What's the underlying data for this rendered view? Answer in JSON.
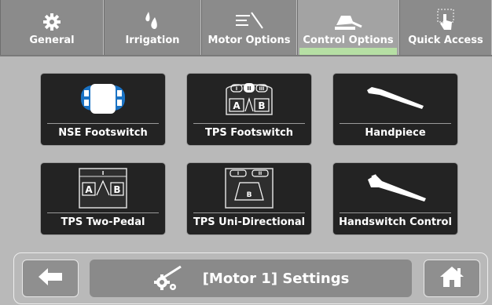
{
  "tabs": [
    {
      "label": "General",
      "icon": "gear-icon"
    },
    {
      "label": "Irrigation",
      "icon": "water-drops-icon"
    },
    {
      "label": "Motor Options",
      "icon": "motor-options-icon"
    },
    {
      "label": "Control Options",
      "icon": "control-options-icon",
      "active": true
    },
    {
      "label": "Quick Access",
      "icon": "touch-hand-icon"
    }
  ],
  "tiles": [
    {
      "label": "NSE Footswitch",
      "icon": "nse-footswitch-icon"
    },
    {
      "label": "TPS Footswitch",
      "icon": "tps-footswitch-icon"
    },
    {
      "label": "Handpiece",
      "icon": "handpiece-icon"
    },
    {
      "label": "TPS Two-Pedal",
      "icon": "tps-two-pedal-icon"
    },
    {
      "label": "TPS Uni-Directional",
      "icon": "tps-uni-directional-icon"
    },
    {
      "label": "Handswitch Control",
      "icon": "handswitch-control-icon"
    }
  ],
  "footswitch_labels": {
    "left": "A",
    "right": "B",
    "uni": "B",
    "mark_one": "I",
    "mark_two": "II",
    "mark_three": "III"
  },
  "bottom": {
    "back_icon": "arrow-left-icon",
    "settings_label": "[Motor 1] Settings",
    "settings_icon": "motor-gear-icon",
    "home_icon": "home-icon"
  },
  "colors": {
    "tab_bar": "#8b8b8b",
    "active_indicator": "#b6dfa4",
    "tile": "#232323",
    "background": "#b9b9b9"
  }
}
